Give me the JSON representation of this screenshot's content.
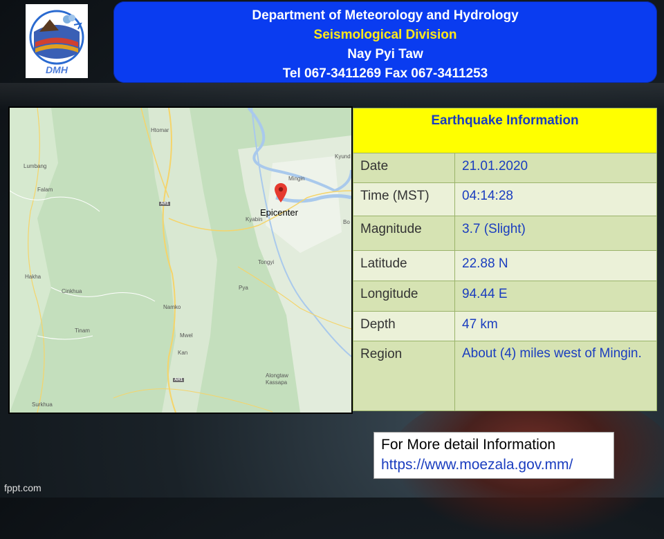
{
  "logo": {
    "text": "DMH"
  },
  "header": {
    "line1": "Department of Meteorology and Hydrology",
    "line2": "Seismological  Division",
    "line3": "Nay Pyi Taw",
    "line4": "Tel 067-3411269  Fax 067-3411253"
  },
  "map": {
    "epicenter_label": "Epicenter",
    "places": {
      "htomar": "Htomar",
      "mingin": "Mingin",
      "kyun": "Kyund",
      "lumbang": "Lumbang",
      "falam": "Falam",
      "kyabin": "Kyabin",
      "bo": "Bo",
      "tongyi": "Tongyi",
      "hakha": "Hakha",
      "cinkhua": "Cinkhua",
      "pya": "Pya",
      "namko": "Namko",
      "mwel": "Mwel",
      "tinam": "Tinam",
      "kan": "Kan",
      "alongtaw": "Alongtaw",
      "kassapa": "Kassapa",
      "surkhua": "Surkhua",
      "ah1_a": "AH1",
      "ah1_b": "AH1"
    }
  },
  "info": {
    "title": "Earthquake Information",
    "rows": [
      {
        "label": "Date",
        "value": "21.01.2020"
      },
      {
        "label": "Time (MST)",
        "value": "04:14:28"
      },
      {
        "label": "Magnitude",
        "value": "3.7 (Slight)"
      },
      {
        "label": "Latitude",
        "value": "22.88 N"
      },
      {
        "label": "Longitude",
        "value": "94.44 E"
      },
      {
        "label": "Depth",
        "value": "47 km"
      },
      {
        "label": "Region",
        "value": "About (4) miles west of Mingin."
      }
    ]
  },
  "more_info": {
    "line1": "For More detail Information",
    "line2": "https://www.moezala.gov.mm/"
  },
  "footer": {
    "watermark": "fppt.com"
  }
}
